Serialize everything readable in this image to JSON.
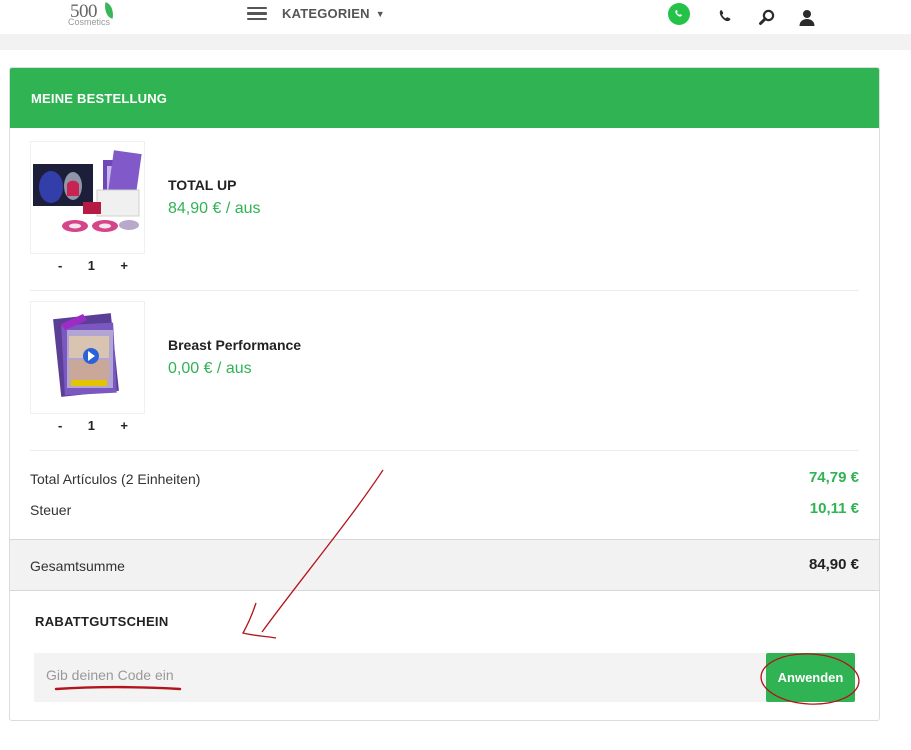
{
  "header": {
    "logo_number": "500",
    "logo_text": "Cosmetics",
    "menu_label": "KATEGORIEN",
    "icons": [
      "whatsapp-icon",
      "phone-icon",
      "search-icon",
      "user-icon"
    ]
  },
  "order": {
    "title": "MEINE BESTELLUNG",
    "items": [
      {
        "name": "TOTAL UP",
        "price": "84,90 € / aus",
        "qty_minus": "-",
        "qty": "1",
        "qty_plus": "+"
      },
      {
        "name": "Breast Performance",
        "price": "0,00 € / aus",
        "qty_minus": "-",
        "qty": "1",
        "qty_plus": "+"
      }
    ],
    "subtotal_label": "Total Artículos (2 Einheiten)",
    "subtotal_value": "74,79 €",
    "tax_label": "Steuer",
    "tax_value": "10,11 €",
    "total_label": "Gesamtsumme",
    "total_value": "84,90 €"
  },
  "coupon": {
    "title": "RABATTGUTSCHEIN",
    "placeholder": "Gib deinen Code ein",
    "apply_label": "Anwenden"
  },
  "colors": {
    "accent": "#2fb353",
    "annotation": "#b3131b"
  }
}
